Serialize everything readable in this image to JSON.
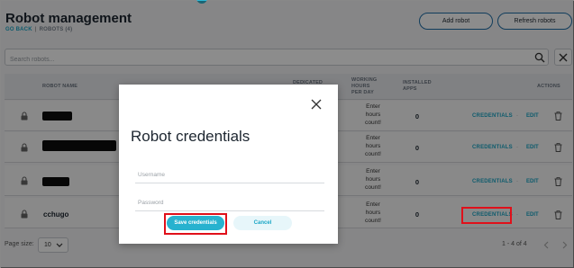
{
  "header": {
    "title": "Robot management",
    "go_back": "GO BACK",
    "separator": "|",
    "breadcrumb_current": "ROBOTS (4)",
    "add_robot": "Add robot",
    "refresh_robots": "Refresh robots"
  },
  "search": {
    "placeholder": "Search robots...",
    "value": ""
  },
  "table": {
    "columns": {
      "robot_name": "ROBOT NAME",
      "dedicated": "DEDICATED",
      "working_hours_1": "WORKING",
      "working_hours_2": "HOURS",
      "working_hours_3": "PER DAY",
      "installed_apps_1": "INSTALLED",
      "installed_apps_2": "APPS",
      "actions": "ACTIONS"
    },
    "rows": [
      {
        "name": "",
        "hours_1": "Enter",
        "hours_2": "hours",
        "hours_3": "count!",
        "apps": "0",
        "credentials": "CREDENTIALS",
        "dot": "·",
        "edit": "EDIT"
      },
      {
        "name": "",
        "hours_1": "Enter",
        "hours_2": "hours",
        "hours_3": "count!",
        "apps": "0",
        "credentials": "CREDENTIALS",
        "dot": "·",
        "edit": "EDIT"
      },
      {
        "name": "",
        "hours_1": "Enter",
        "hours_2": "hours",
        "hours_3": "count!",
        "apps": "0",
        "credentials": "CREDENTIALS",
        "dot": "·",
        "edit": "EDIT"
      },
      {
        "name": "cchugo",
        "hours_1": "Enter",
        "hours_2": "hours",
        "hours_3": "count!",
        "apps": "0",
        "credentials": "CREDENTIALS",
        "dot": "·",
        "edit": "EDIT"
      }
    ]
  },
  "footer": {
    "page_size_label": "Page size:",
    "page_size_value": "10",
    "range": "1 - 4 of 4"
  },
  "modal": {
    "title": "Robot credentials",
    "username_placeholder": "Username",
    "password_placeholder": "Password",
    "save_label": "Save credentials",
    "cancel_label": "Cancel"
  },
  "colors": {
    "accent": "#27b2cf",
    "link": "#1aa6c6",
    "highlight": "#e0101a",
    "dark_text": "#1d2630"
  },
  "icons": [
    "lock-icon",
    "trash-icon",
    "search-icon",
    "close-icon",
    "chevron-down-icon",
    "chevron-left-icon",
    "chevron-right-icon"
  ]
}
